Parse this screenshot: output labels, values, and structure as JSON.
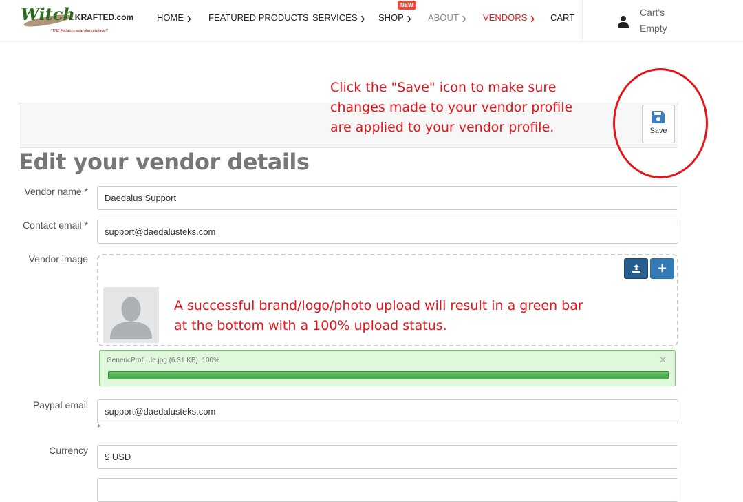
{
  "header": {
    "logo_text": "WitchKrafted.com",
    "logo_tagline": "\"THE Metaphysical Marketplace!\"",
    "nav": [
      {
        "label": "HOME",
        "chevron": true,
        "color": "#222222"
      },
      {
        "label": "FEATURED PRODUCTS",
        "chevron": false,
        "color": "#222222"
      },
      {
        "label": "SERVICES",
        "chevron": true,
        "color": "#222222"
      },
      {
        "label": "SHOP",
        "chevron": true,
        "color": "#222222"
      },
      {
        "label": "ABOUT",
        "chevron": true,
        "color": "#888888"
      },
      {
        "label": "VENDORS",
        "chevron": true,
        "color": "#e4161b"
      },
      {
        "label": "CART",
        "chevron": false,
        "color": "#222222"
      }
    ],
    "shop_badge": "NEW",
    "cart_line1": "Cart's",
    "cart_line2": "Empty"
  },
  "annotations": {
    "save_note": [
      "Click the \"Save\" icon to make sure",
      "changes made to your vendor profile",
      "are applied to your vendor profile."
    ],
    "upload_note": [
      "A successful brand/logo/photo upload will result in a green bar",
      "at the bottom with a 100% upload status."
    ],
    "color": "#e4161b"
  },
  "toolbar": {
    "save_label": "Save"
  },
  "page_title": "Edit your vendor details",
  "form": {
    "vendor_name": {
      "label": "Vendor name *",
      "value": "Daedalus Support"
    },
    "contact_email": {
      "label": "Contact email *",
      "value": "support@daedalusteks.com"
    },
    "vendor_image": {
      "label": "Vendor image"
    },
    "upload": {
      "file": "GenericProfi...le.jpg (6.31 KB)",
      "percent_label": "100%",
      "progress": 100,
      "color": "#5cb85c"
    },
    "paypal_email": {
      "label": "Paypal email",
      "value": "support@daedalusteks.com",
      "required_mark": "*"
    },
    "currency": {
      "label": "Currency",
      "value": "$ USD"
    }
  }
}
